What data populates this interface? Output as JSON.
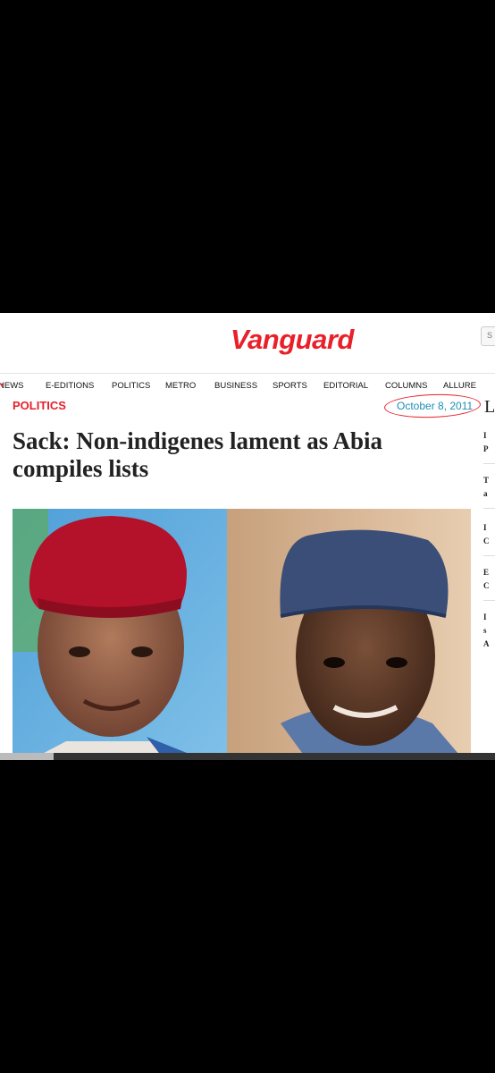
{
  "site": {
    "logo": "Vanguard",
    "search_placeholder": "S"
  },
  "nav": {
    "items": [
      {
        "label": "NEWS",
        "has_dropdown": true
      },
      {
        "label": "E-EDITIONS"
      },
      {
        "label": "POLITICS"
      },
      {
        "label": "METRO"
      },
      {
        "label": "BUSINESS"
      },
      {
        "label": "SPORTS"
      },
      {
        "label": "EDITORIAL"
      },
      {
        "label": "COLUMNS"
      },
      {
        "label": "ALLURE"
      }
    ]
  },
  "article": {
    "section": "POLITICS",
    "date": "October 8, 2011",
    "headline": "Sack: Non-indigenes lament as Abia compiles lists",
    "image_icon": "two-portraits-photo"
  },
  "sidebar": {
    "title_partial": "L",
    "items": [
      {
        "line1": "I",
        "line2": "P"
      },
      {
        "line1": "T",
        "line2": "a"
      },
      {
        "line1": "I",
        "line2": "C"
      },
      {
        "line1": "E",
        "line2": "C"
      },
      {
        "line1": "I",
        "line2": "s",
        "line3": "A"
      }
    ]
  },
  "colors": {
    "brand_red": "#e8202a",
    "date_blue": "#1b8fb7",
    "background": "#000000"
  }
}
